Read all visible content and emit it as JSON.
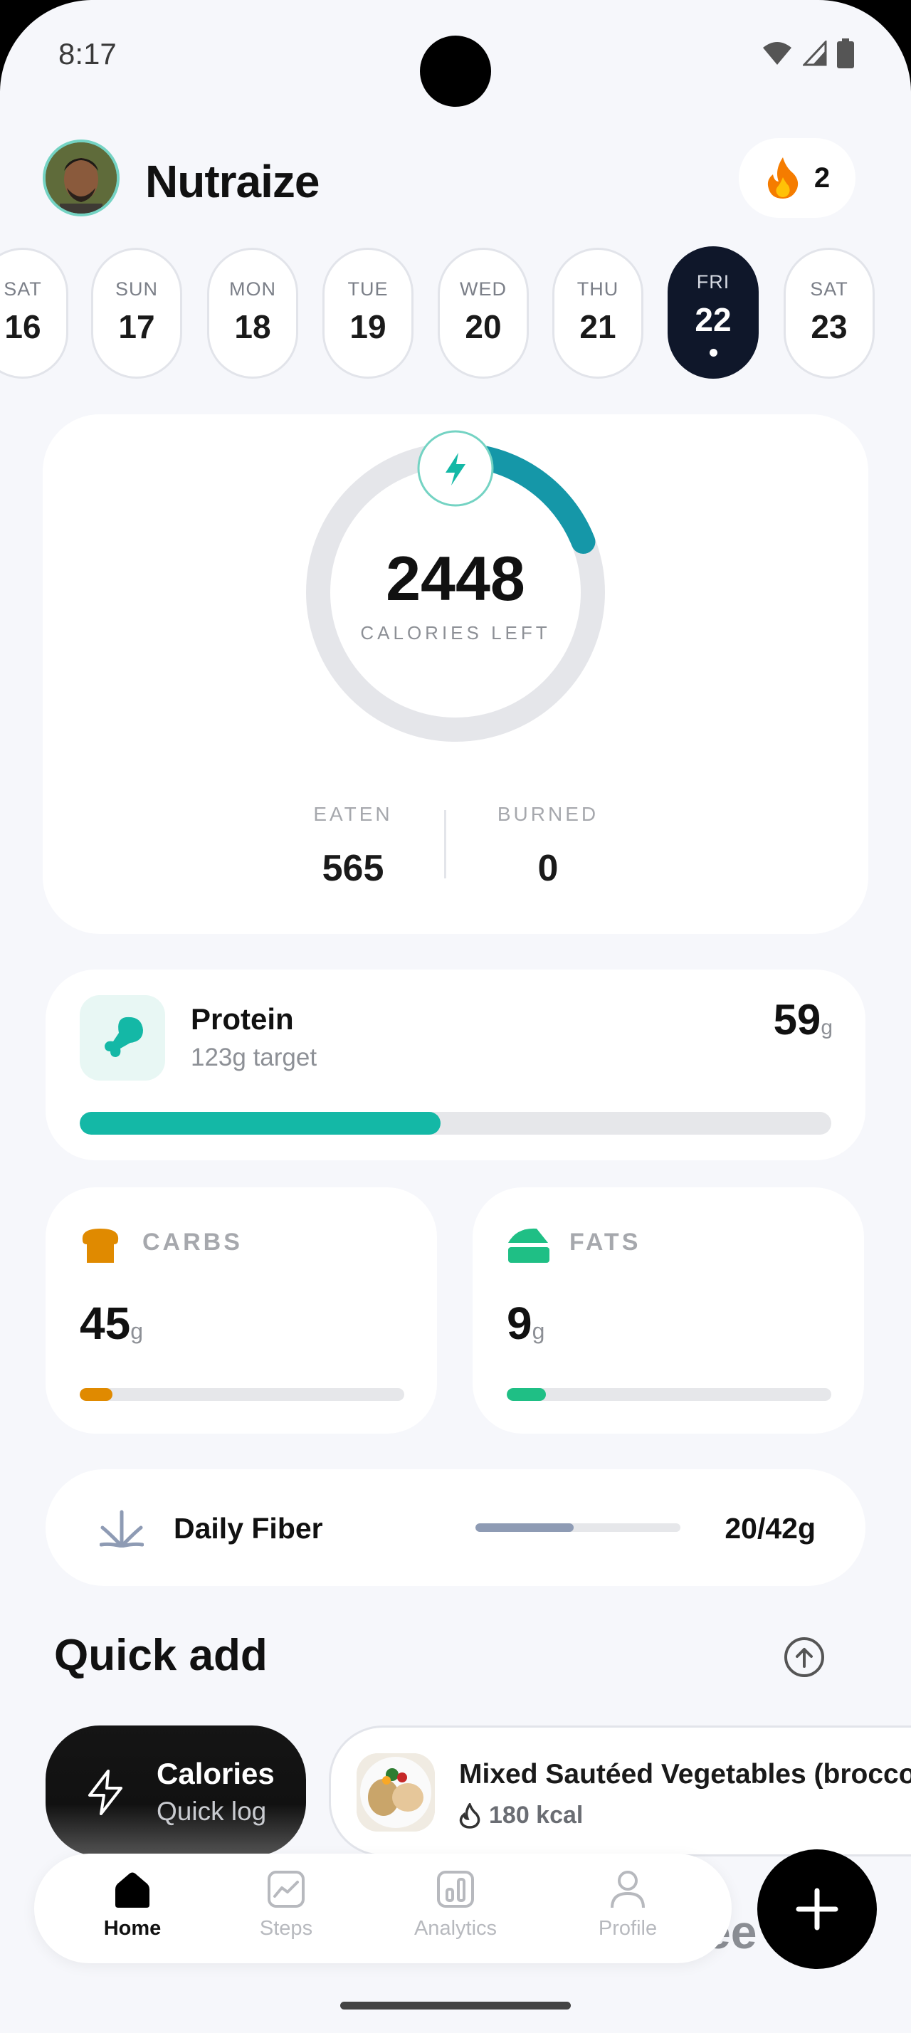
{
  "status_bar": {
    "time": "8:17"
  },
  "header": {
    "title": "Nutraize",
    "streak_count": "2"
  },
  "days": [
    {
      "name": "SAT",
      "num": "16",
      "active": false
    },
    {
      "name": "SUN",
      "num": "17",
      "active": false
    },
    {
      "name": "MON",
      "num": "18",
      "active": false
    },
    {
      "name": "TUE",
      "num": "19",
      "active": false
    },
    {
      "name": "WED",
      "num": "20",
      "active": false
    },
    {
      "name": "THU",
      "num": "21",
      "active": false
    },
    {
      "name": "FRI",
      "num": "22",
      "active": true
    },
    {
      "name": "SAT",
      "num": "23",
      "active": false
    }
  ],
  "calories": {
    "left_value": "2448",
    "left_label": "CALORIES LEFT",
    "progress_fraction": 0.19,
    "eaten_label": "EATEN",
    "eaten_value": "565",
    "burned_label": "BURNED",
    "burned_value": "0"
  },
  "protein": {
    "title": "Protein",
    "subtitle": "123g target",
    "value": "59",
    "unit": "g",
    "progress_fraction": 0.48
  },
  "carbs": {
    "label": "CARBS",
    "value": "45",
    "unit": "g",
    "progress_fraction": 0.1
  },
  "fats": {
    "label": "FATS",
    "value": "9",
    "unit": "g",
    "progress_fraction": 0.12
  },
  "fiber": {
    "label": "Daily Fiber",
    "value": "20/42g",
    "progress_fraction": 0.48
  },
  "quick_add": {
    "title": "Quick add",
    "calories_card": {
      "title": "Calories",
      "subtitle": "Quick log"
    },
    "food_card": {
      "name": "Mixed Sautéed Vegetables (broccoli",
      "kcal": "180 kcal"
    }
  },
  "nav": {
    "items": [
      {
        "label": "Home",
        "icon": "home-icon",
        "active": true
      },
      {
        "label": "Steps",
        "icon": "steps-icon",
        "active": false
      },
      {
        "label": "Analytics",
        "icon": "analytics-icon",
        "active": false
      },
      {
        "label": "Profile",
        "icon": "profile-icon",
        "active": false
      }
    ],
    "ghost_text": "ee"
  },
  "colors": {
    "teal": "#14b8a6",
    "ring_progress": "#1597a8",
    "carbs": "#e08a00",
    "fats": "#1fbf85",
    "fiber": "#8e9bb4",
    "active_day": "#0f172a"
  }
}
